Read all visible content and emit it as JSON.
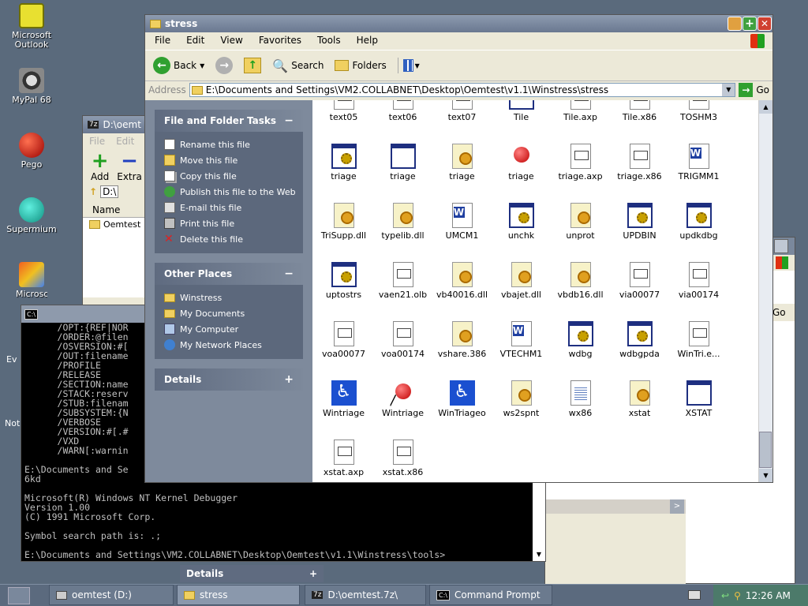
{
  "desktop_icons": [
    {
      "name": "outlook",
      "label": "Microsoft Outlook",
      "icon": "envelope-icon"
    },
    {
      "name": "mypal",
      "label": "MyPal 68",
      "icon": "raccoon-icon"
    },
    {
      "name": "pego",
      "label": "Pego",
      "icon": "red-ball-icon"
    },
    {
      "name": "supermium",
      "label": "Supermium",
      "icon": "globe-icon"
    },
    {
      "name": "microsoft-visual",
      "label": "Microsoft Visu",
      "icon": "infinity-icon"
    }
  ],
  "desktop_partial_labels": {
    "ev": "Ev",
    "not": "Not"
  },
  "explorer": {
    "title": "stress",
    "menu": [
      "File",
      "Edit",
      "View",
      "Favorites",
      "Tools",
      "Help"
    ],
    "toolbar": {
      "back": "Back",
      "search": "Search",
      "folders": "Folders"
    },
    "address_label": "Address",
    "address_value": "E:\\Documents and Settings\\VM2.COLLABNET\\Desktop\\Oemtest\\v1.1\\Winstress\\stress",
    "go": "Go",
    "file_tasks": {
      "title": "File and Folder Tasks",
      "toggle": "−",
      "items": [
        "Rename this file",
        "Move this file",
        "Copy this file",
        "Publish this file to the Web",
        "E-mail this file",
        "Print this file",
        "Delete this file"
      ]
    },
    "other_places": {
      "title": "Other Places",
      "toggle": "−",
      "items": [
        "Winstress",
        "My Documents",
        "My Computer",
        "My Network Places"
      ]
    },
    "details": {
      "title": "Details",
      "toggle": "+"
    },
    "files": [
      [
        {
          "n": "text05",
          "t": "doc"
        },
        {
          "n": "text06",
          "t": "doc"
        },
        {
          "n": "text07",
          "t": "doc"
        },
        {
          "n": "Tile",
          "t": "win"
        },
        {
          "n": "Tile.axp",
          "t": "doc"
        },
        {
          "n": "Tile.x86",
          "t": "doc"
        },
        {
          "n": "TOSHM3",
          "t": "doc"
        }
      ],
      [
        {
          "n": "triage",
          "t": "app"
        },
        {
          "n": "triage",
          "t": "win"
        },
        {
          "n": "triage",
          "t": "dll"
        },
        {
          "n": "triage",
          "t": "red"
        },
        {
          "n": "triage.axp",
          "t": "doc"
        },
        {
          "n": "triage.x86",
          "t": "doc"
        },
        {
          "n": "TRIGMM1",
          "t": "word"
        }
      ],
      [
        {
          "n": "TriSupp.dll",
          "t": "dll"
        },
        {
          "n": "typelib.dll",
          "t": "dll"
        },
        {
          "n": "UMCM1",
          "t": "word"
        },
        {
          "n": "unchk",
          "t": "app"
        },
        {
          "n": "unprot",
          "t": "dll"
        },
        {
          "n": "UPDBIN",
          "t": "app"
        },
        {
          "n": "updkdbg",
          "t": "app"
        }
      ],
      [
        {
          "n": "uptostrs",
          "t": "app"
        },
        {
          "n": "vaen21.olb",
          "t": "doc"
        },
        {
          "n": "vb40016.dll",
          "t": "dll"
        },
        {
          "n": "vbajet.dll",
          "t": "dll"
        },
        {
          "n": "vbdb16.dll",
          "t": "dll"
        },
        {
          "n": "via00077",
          "t": "doc"
        },
        {
          "n": "via00174",
          "t": "doc"
        }
      ],
      [
        {
          "n": "voa00077",
          "t": "doc"
        },
        {
          "n": "voa00174",
          "t": "doc"
        },
        {
          "n": "vshare.386",
          "t": "dll"
        },
        {
          "n": "VTECHM1",
          "t": "word"
        },
        {
          "n": "wdbg",
          "t": "app"
        },
        {
          "n": "wdbgpda",
          "t": "app"
        },
        {
          "n": "WinTri.e...",
          "t": "doc"
        }
      ],
      [
        {
          "n": "Wintriage",
          "t": "wheel"
        },
        {
          "n": "Wintriage",
          "t": "red"
        },
        {
          "n": "WinTriageo",
          "t": "wheel"
        },
        {
          "n": "ws2spnt",
          "t": "dll"
        },
        {
          "n": "wx86",
          "t": "txt"
        },
        {
          "n": "xstat",
          "t": "dll"
        },
        {
          "n": "XSTAT",
          "t": "win"
        }
      ],
      [
        {
          "n": "xstat.axp",
          "t": "doc"
        },
        {
          "n": "xstat.x86",
          "t": "doc"
        }
      ]
    ]
  },
  "zip_window": {
    "title": "D:\\oemt",
    "menu": [
      "File",
      "Edit"
    ],
    "add": "Add",
    "extra": "Extra",
    "path": "D:\\",
    "col_name": "Name",
    "row1": "Oemtest"
  },
  "console_lines": [
    "      /OPT:{REF|NOR",
    "      /ORDER:@filen",
    "      /OSVERSION:#[",
    "      /OUT:filename",
    "      /PROFILE",
    "      /RELEASE",
    "      /SECTION:name",
    "      /STACK:reserv",
    "      /STUB:filenam",
    "      /SUBSYSTEM:{N",
    "      /VERBOSE",
    "      /VERSION:#[.#",
    "      /VXD",
    "      /WARN[:warnin",
    "",
    "E:\\Documents and Se",
    "6kd",
    "",
    "Microsoft(R) Windows NT Kernel Debugger",
    "Version 1.00",
    "(C) 1991 Microsoft Corp.",
    "",
    "Symbol search path is: .;",
    "",
    "E:\\Documents and Settings\\VM2.COLLABNET\\Desktop\\Oemtest\\v1.1\\Winstress\\tools>"
  ],
  "back_window": {
    "go": "Go",
    "details": "Details",
    "toggle": "+"
  },
  "taskbar": {
    "buttons": [
      {
        "label": "oemtest (D:)",
        "icon": "drive-icon"
      },
      {
        "label": "stress",
        "icon": "folder-icon"
      },
      {
        "label": "D:\\oemtest.7z\\",
        "icon": "7zip-icon"
      },
      {
        "label": "Command Prompt",
        "icon": "cmd-icon"
      }
    ],
    "clock": "12:26 AM"
  }
}
